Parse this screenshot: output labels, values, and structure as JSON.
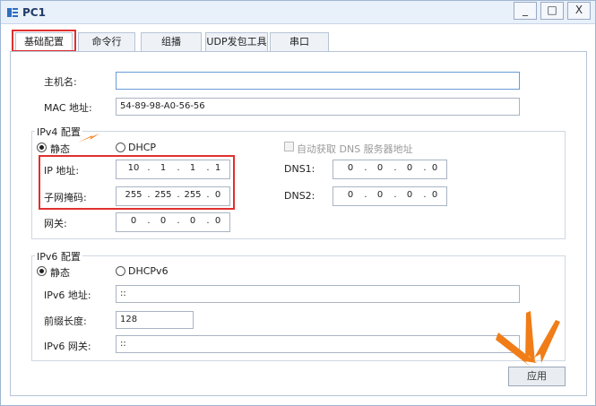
{
  "window": {
    "title": "PC1",
    "min_glyph": "_",
    "max_glyph": "□",
    "close_glyph": "X"
  },
  "tabs": [
    {
      "label": "基础配置",
      "active": true
    },
    {
      "label": "命令行",
      "active": false
    },
    {
      "label": "组播",
      "active": false
    },
    {
      "label": "UDP发包工具",
      "active": false
    },
    {
      "label": "串口",
      "active": false
    }
  ],
  "basic": {
    "hostname_label": "主机名:",
    "hostname_value": "",
    "mac_label": "MAC 地址:",
    "mac_value": "54-89-98-A0-56-56"
  },
  "ipv4": {
    "group_title": "IPv4 配置",
    "static_label": "静态",
    "dhcp_label": "DHCP",
    "mode": "static",
    "auto_dns_label": "自动获取 DNS 服务器地址",
    "auto_dns_checked": false,
    "auto_dns_enabled": false,
    "ip_label": "IP 地址:",
    "ip": [
      "10",
      "1",
      "1",
      "1"
    ],
    "mask_label": "子网掩码:",
    "mask": [
      "255",
      "255",
      "255",
      "0"
    ],
    "gateway_label": "网关:",
    "gateway": [
      "0",
      "0",
      "0",
      "0"
    ],
    "dns1_label": "DNS1:",
    "dns1": [
      "0",
      "0",
      "0",
      "0"
    ],
    "dns2_label": "DNS2:",
    "dns2": [
      "0",
      "0",
      "0",
      "0"
    ]
  },
  "ipv6": {
    "group_title": "IPv6 配置",
    "static_label": "静态",
    "dhcp_label": "DHCPv6",
    "mode": "static",
    "addr_label": "IPv6 地址:",
    "addr_value": "::",
    "prefix_label": "前缀长度:",
    "prefix_value": "128",
    "gateway_label": "IPv6 网关:",
    "gateway_value": "::"
  },
  "apply_label": "应用",
  "colors": {
    "highlight": "#e0302f",
    "arrow": "#f07d17",
    "titlebar": "#e8f0fa"
  }
}
